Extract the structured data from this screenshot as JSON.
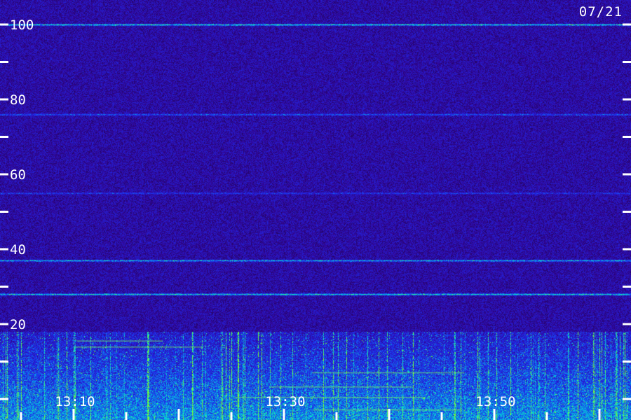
{
  "date_label": "07/21",
  "colors": {
    "background": "#20124e",
    "ticks": "#ffffff",
    "labels": "#ffffff"
  },
  "chart_data": {
    "type": "heatmap",
    "title": "",
    "xlabel": "",
    "ylabel": "",
    "x_tick_labels": [
      "13:10",
      "13:30",
      "13:50"
    ],
    "x_tick_values": [
      "13:10",
      "13:30",
      "13:50"
    ],
    "x_range": [
      "13:03",
      "14:03"
    ],
    "x_minor_tick_minutes": 5,
    "y_tick_labels": [
      "100",
      "80",
      "60",
      "40",
      "20"
    ],
    "y_tick_values": [
      100,
      80,
      60,
      40,
      20
    ],
    "y_minor_tick_values": [
      90,
      70,
      50,
      30,
      10,
      0
    ],
    "ylim": [
      0,
      110
    ],
    "colormap": "dark-blue to cyan to green intensity",
    "background_level": 0.15,
    "horizontal_bands": [
      {
        "y": 100,
        "level": 0.55
      },
      {
        "y": 76,
        "level": 0.3
      },
      {
        "y": 55,
        "level": 0.22
      },
      {
        "y": 37,
        "level": 0.45
      },
      {
        "y": 28,
        "level": 0.55
      }
    ],
    "high_activity_range": [
      0,
      18
    ]
  }
}
